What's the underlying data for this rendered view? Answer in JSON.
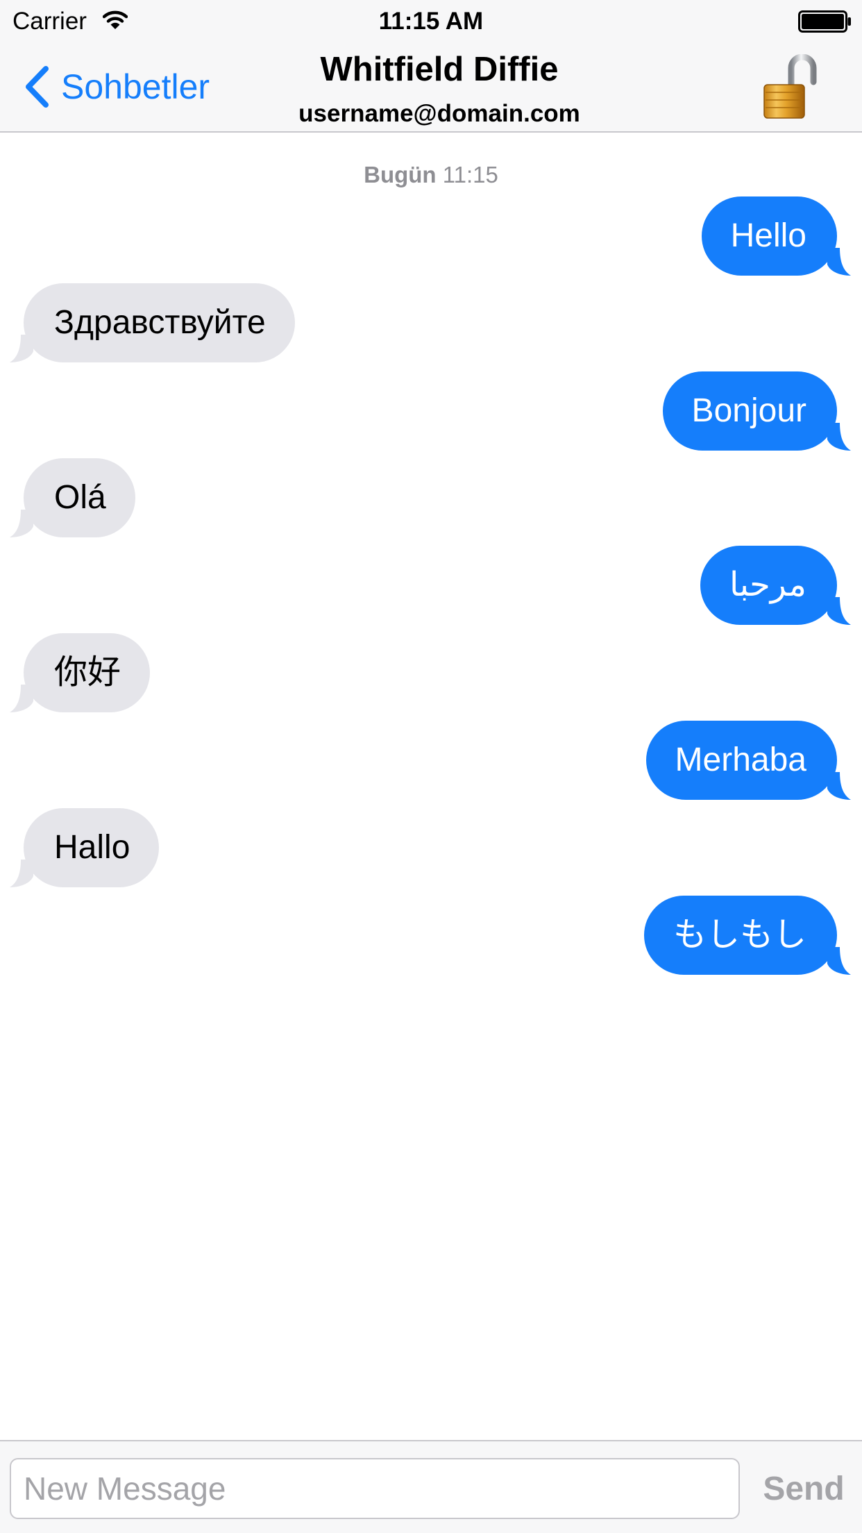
{
  "status_bar": {
    "carrier": "Carrier",
    "time": "11:15 AM",
    "wifi_icon": "wifi-icon",
    "battery_icon": "battery-full-icon"
  },
  "nav": {
    "back_label": "Sohbetler",
    "back_icon": "chevron-left-icon",
    "title": "Whitfield Diffie",
    "subtitle": "username@domain.com",
    "lock_icon": "open-padlock-icon"
  },
  "conversation": {
    "timestamp_day": "Bugün",
    "timestamp_time": "11:15",
    "messages": [
      {
        "direction": "outgoing",
        "text": "Hello"
      },
      {
        "direction": "incoming",
        "text": "Здравствуйте"
      },
      {
        "direction": "outgoing",
        "text": "Bonjour"
      },
      {
        "direction": "incoming",
        "text": "Olá"
      },
      {
        "direction": "outgoing",
        "text": "مرحبا"
      },
      {
        "direction": "incoming",
        "text": "你好"
      },
      {
        "direction": "outgoing",
        "text": "Merhaba"
      },
      {
        "direction": "incoming",
        "text": "Hallo"
      },
      {
        "direction": "outgoing",
        "text": "もしもし"
      }
    ]
  },
  "composer": {
    "placeholder": "New Message",
    "value": "",
    "send_label": "Send"
  },
  "colors": {
    "accent": "#157efb",
    "outgoing_bubble": "#157efb",
    "incoming_bubble": "#e5e5ea",
    "bar_background": "#f7f7f8",
    "secondary_text": "#8e8e93"
  }
}
